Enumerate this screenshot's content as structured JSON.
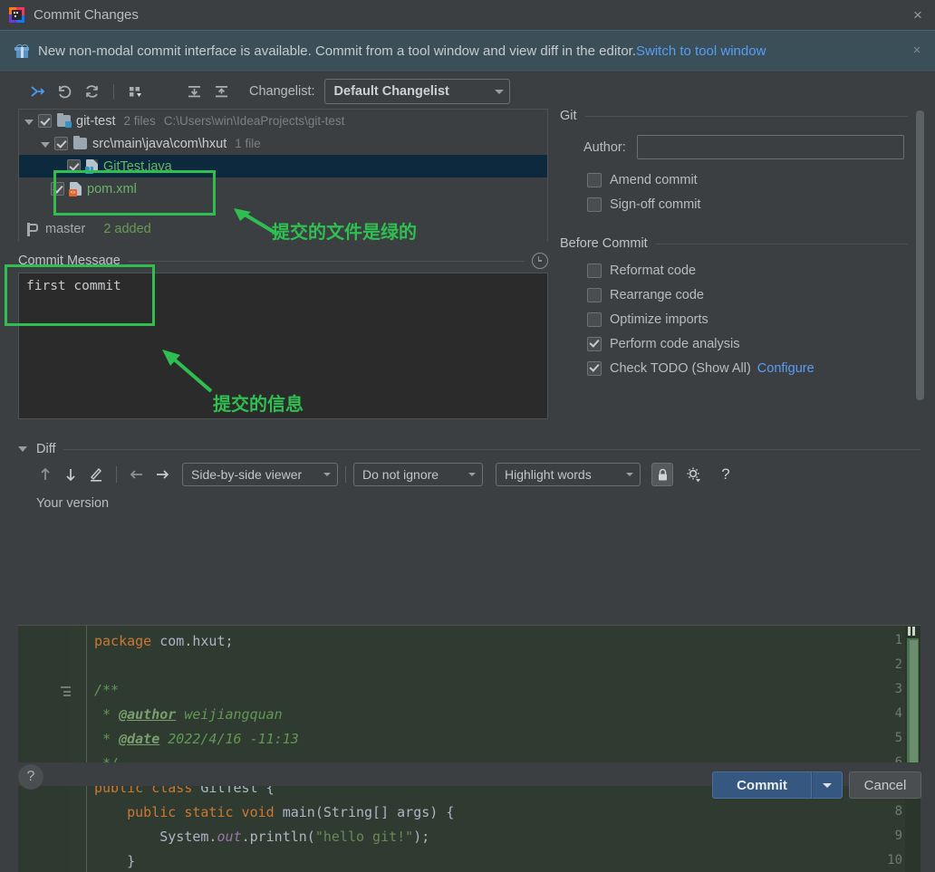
{
  "window": {
    "title": "Commit Changes",
    "icon": "intellij-idea-icon",
    "close_label": "×"
  },
  "banner": {
    "icon": "gift-icon",
    "text": "New non-modal commit interface is available. Commit from a tool window and view diff in the editor.",
    "link": "Switch to tool window",
    "close_label": "×"
  },
  "toolbar": {
    "buttons": [
      {
        "name": "show-diff-icon",
        "glyph": "diff"
      },
      {
        "name": "revert-icon",
        "glyph": "revert"
      },
      {
        "name": "refresh-icon",
        "glyph": "refresh"
      },
      {
        "name": "group-by-icon",
        "glyph": "group"
      },
      {
        "name": "expand-all-icon",
        "glyph": "expand"
      },
      {
        "name": "collapse-all-icon",
        "glyph": "collapse"
      }
    ],
    "changelist_label": "Changelist:",
    "changelist_value": "Default Changelist"
  },
  "file_tree": {
    "rows": [
      {
        "indent": 0,
        "expander": "down",
        "checked": true,
        "icon": "module-folder-icon",
        "name": "git-test",
        "name_color": "plain",
        "meta": [
          "2 files",
          "C:\\Users\\win\\IdeaProjects\\git-test"
        ],
        "selected": false
      },
      {
        "indent": 1,
        "expander": "down",
        "checked": true,
        "icon": "folder-icon",
        "name": "src\\main\\java\\com\\hxut",
        "name_color": "plain",
        "meta": [
          "1 file"
        ],
        "selected": false
      },
      {
        "indent": 2,
        "expander": "none",
        "checked": true,
        "icon": "java-file-icon",
        "name": "GitTest.java",
        "name_color": "green",
        "meta": [],
        "selected": true
      },
      {
        "indent": 1,
        "expander": "none",
        "checked": true,
        "icon": "xml-file-icon",
        "name": "pom.xml",
        "name_color": "green",
        "meta": [],
        "selected": false
      }
    ]
  },
  "status_bar": {
    "branch_icon": "git-branch-icon",
    "branch": "master",
    "added": "2 added"
  },
  "commit_message": {
    "label": "Commit Message",
    "history_icon": "clock-history-icon",
    "value": "first commit",
    "placeholder": ""
  },
  "git_section": {
    "title": "Git",
    "author_label": "Author:",
    "author_value": "",
    "author_placeholder": "",
    "options": [
      {
        "label": "Amend commit",
        "checked": false,
        "name": "amend-commit-checkbox"
      },
      {
        "label": "Sign-off commit",
        "checked": false,
        "name": "sign-off-commit-checkbox"
      }
    ]
  },
  "before_commit_section": {
    "title": "Before Commit",
    "options": [
      {
        "label": "Reformat code",
        "checked": false,
        "name": "reformat-code-checkbox",
        "link": ""
      },
      {
        "label": "Rearrange code",
        "checked": false,
        "name": "rearrange-code-checkbox",
        "link": ""
      },
      {
        "label": "Optimize imports",
        "checked": false,
        "name": "optimize-imports-checkbox",
        "link": ""
      },
      {
        "label": "Perform code analysis",
        "checked": true,
        "name": "perform-code-analysis-checkbox",
        "link": ""
      },
      {
        "label": "Check TODO (Show All)",
        "checked": true,
        "name": "check-todo-checkbox",
        "link": "Configure"
      }
    ]
  },
  "diff_section": {
    "title": "Diff",
    "viewer_mode": "Side-by-side viewer",
    "ignore_mode": "Do not ignore",
    "highlight_mode": "Highlight words",
    "lock_icon": "lock-icon",
    "settings_icon": "gear-icon",
    "help_icon": "question-mark-icon",
    "pane_label": "Your version",
    "nav_icons": [
      {
        "name": "previous-difference-icon",
        "glyph": "↑"
      },
      {
        "name": "next-difference-icon",
        "glyph": "↓"
      },
      {
        "name": "annotate-icon",
        "glyph": "pencil"
      },
      {
        "name": "accept-left-icon",
        "glyph": "←"
      },
      {
        "name": "accept-right-icon",
        "glyph": "→"
      }
    ]
  },
  "editor": {
    "lines": [
      {
        "num": "1",
        "fold": false,
        "tokens": [
          {
            "t": "package ",
            "c": "kw"
          },
          {
            "t": "com.hxut;",
            "c": "pl"
          }
        ]
      },
      {
        "num": "2",
        "fold": false,
        "tokens": []
      },
      {
        "num": "3",
        "fold": true,
        "tokens": [
          {
            "t": "/**",
            "c": "cm"
          }
        ]
      },
      {
        "num": "4",
        "fold": false,
        "tokens": [
          {
            "t": " * ",
            "c": "cm"
          },
          {
            "t": "@author",
            "c": "tag"
          },
          {
            "t": " weijiangquan",
            "c": "cm"
          }
        ]
      },
      {
        "num": "5",
        "fold": false,
        "tokens": [
          {
            "t": " * ",
            "c": "cm"
          },
          {
            "t": "@date",
            "c": "tag"
          },
          {
            "t": " 2022/4/16 -11:13",
            "c": "cm"
          }
        ]
      },
      {
        "num": "6",
        "fold": false,
        "tokens": [
          {
            "t": " */",
            "c": "cm"
          }
        ]
      },
      {
        "num": "7",
        "fold": false,
        "tokens": [
          {
            "t": "public class ",
            "c": "kw"
          },
          {
            "t": "GitTest {",
            "c": "pl"
          }
        ]
      },
      {
        "num": "8",
        "fold": false,
        "tokens": [
          {
            "t": "    ",
            "c": "pl"
          },
          {
            "t": "public static void ",
            "c": "kw"
          },
          {
            "t": "main(String[] args) {",
            "c": "pl"
          }
        ]
      },
      {
        "num": "9",
        "fold": false,
        "tokens": [
          {
            "t": "        System.",
            "c": "pl"
          },
          {
            "t": "out",
            "c": "fld"
          },
          {
            "t": ".println(",
            "c": "pl"
          },
          {
            "t": "\"hello git!\"",
            "c": "str"
          },
          {
            "t": ");",
            "c": "pl"
          }
        ]
      },
      {
        "num": "10",
        "fold": false,
        "tokens": [
          {
            "t": "    }",
            "c": "pl"
          }
        ]
      }
    ]
  },
  "footer": {
    "help_label": "?",
    "commit_label": "Commit",
    "commit_dropdown_icon": "chevron-down-icon",
    "cancel_label": "Cancel"
  },
  "annotations": {
    "files_note": "提交的文件是绿的",
    "message_note": "提交的信息",
    "color": "#2fbf51"
  }
}
